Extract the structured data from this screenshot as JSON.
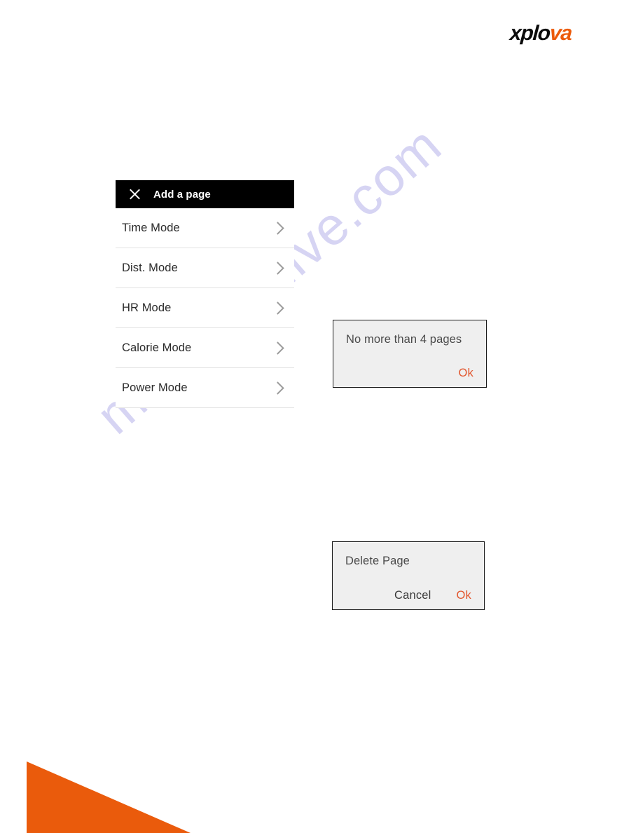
{
  "brand": {
    "name_dark": "xplo",
    "name_accent": "va",
    "accent_color": "#ec5b0c"
  },
  "watermark": {
    "text": "manualshive.com",
    "color": "#cfcdf2"
  },
  "menu": {
    "header": {
      "close_icon": "close-icon",
      "title": "Add a page",
      "background_color": "#000000"
    },
    "items": [
      {
        "label": "Time Mode",
        "chevron": "chevron-right-icon"
      },
      {
        "label": "Dist. Mode",
        "chevron": "chevron-right-icon"
      },
      {
        "label": "HR Mode",
        "chevron": "chevron-right-icon"
      },
      {
        "label": "Calorie Mode",
        "chevron": "chevron-right-icon"
      },
      {
        "label": "Power Mode",
        "chevron": "chevron-right-icon"
      }
    ]
  },
  "dialogs": {
    "max_pages": {
      "message": "No more than 4 pages",
      "ok_label": "Ok",
      "ok_color": "#e2572f"
    },
    "delete_page": {
      "message": "Delete Page",
      "cancel_label": "Cancel",
      "ok_label": "Ok",
      "ok_color": "#e2572f"
    }
  },
  "decoration": {
    "corner_triangle_color": "#ea5b0c"
  }
}
